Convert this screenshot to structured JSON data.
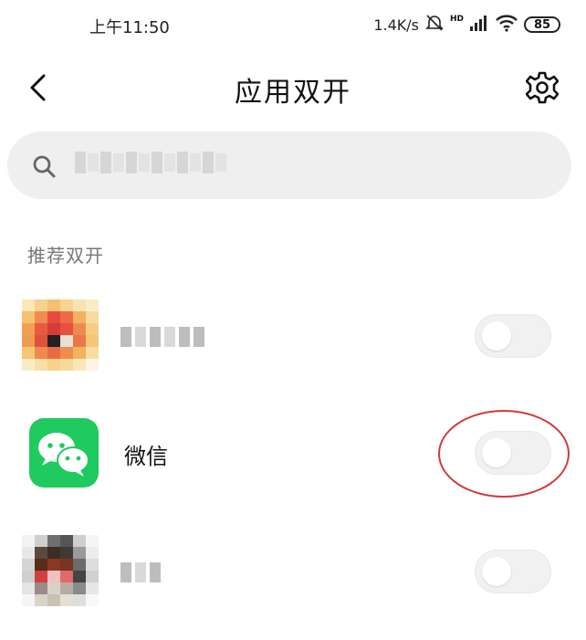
{
  "status_bar": {
    "time": "上午11:50",
    "net_speed": "1.4K/s",
    "network_type": "HD",
    "battery": "85"
  },
  "header": {
    "title": "应用双开"
  },
  "search": {
    "placeholder": ""
  },
  "section": {
    "title": "推荐双开"
  },
  "apps": [
    {
      "name": "",
      "enabled": false
    },
    {
      "name": "微信",
      "enabled": false
    },
    {
      "name": "",
      "enabled": false
    }
  ],
  "colors": {
    "wechat_green": "#1fca5e",
    "annotation_red": "#d23a3a",
    "search_bg": "#efefef"
  },
  "icons": [
    "back-arrow",
    "settings-gear",
    "search-magnifier",
    "mute-bell",
    "signal-bars",
    "wifi",
    "battery"
  ]
}
